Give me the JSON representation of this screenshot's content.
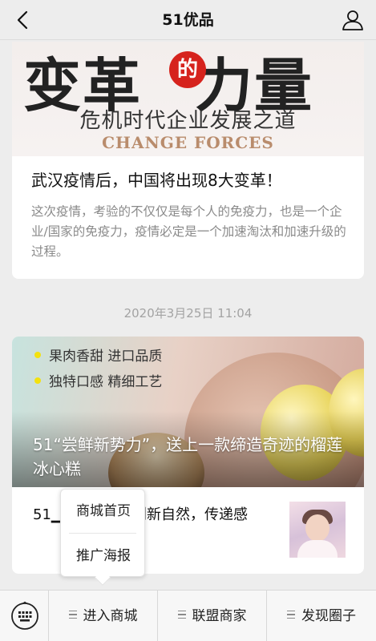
{
  "header": {
    "title": "51优品"
  },
  "article1": {
    "banner_title_1": "变革",
    "banner_title_de": "的",
    "banner_title_2": "力量",
    "banner_subtitle": "危机时代企业发展之道",
    "banner_english": "CHANGE FORCES",
    "headline": "武汉疫情后，中国将出现8大变革！",
    "description": "这次疫情，考验的不仅仅是每个人的免疫力，也是一个企业/国家的免疫力，疫情必定是一个加速淘汰和加速升级的过程。"
  },
  "timestamp": "2020年3月25日 11:04",
  "article2": {
    "feature_1": "果肉香甜 进口品质",
    "feature_2": "独特口感 精细工艺",
    "caption": "51“尝鲜新势力”，送上一款缔造奇迹的榴莲冰心糕",
    "sub_article_text": "51▁▁▁▁▁▁—创新自然，传递感"
  },
  "popup_menu": {
    "items": [
      "商城首页",
      "推广海报"
    ]
  },
  "bottom_bar": {
    "tabs": [
      "进入商城",
      "联盟商家",
      "发现圈子"
    ]
  },
  "colors": {
    "background": "#ededed",
    "accent_red": "#d6231d",
    "feature_dot": "#f3e10f"
  }
}
